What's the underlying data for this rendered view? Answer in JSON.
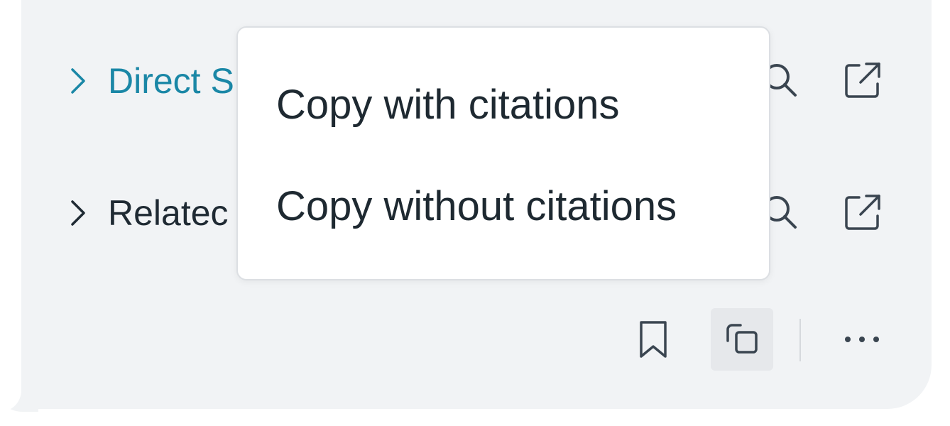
{
  "rows": [
    {
      "label": "Direct S",
      "color": "#1a87a6",
      "icon": "chevron-right-icon"
    },
    {
      "label": "Relatec",
      "color": "#1f2a33",
      "icon": "chevron-right-icon"
    }
  ],
  "row_actions": [
    "search-icon",
    "external-link-icon"
  ],
  "menu": {
    "items": [
      {
        "label": "Copy with citations"
      },
      {
        "label": "Copy without citations"
      }
    ]
  },
  "toolbar": {
    "icons": [
      "bookmark-icon",
      "copy-icon",
      "more-icon"
    ],
    "active": "copy-icon"
  }
}
